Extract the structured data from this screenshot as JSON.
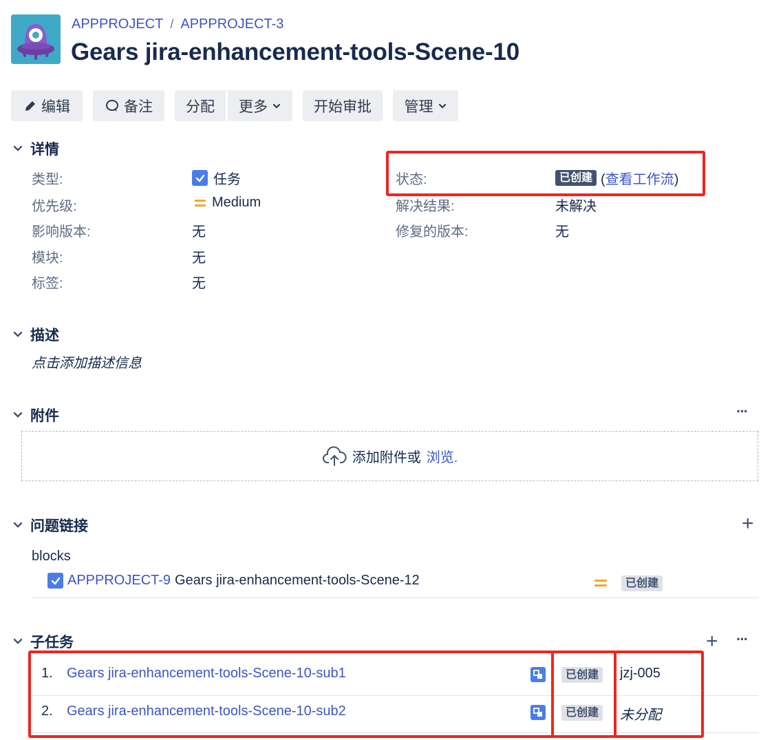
{
  "header": {
    "breadcrumbs": [
      "APPPROJECT",
      "APPPROJECT-3"
    ],
    "separator": "/",
    "summary": "Gears jira-enhancement-tools-Scene-10"
  },
  "toolbar": {
    "edit_label": "编辑",
    "comment_label": "备注",
    "assign_label": "分配",
    "more_label": "更多",
    "start_approval_label": "开始审批",
    "admin_label": "管理"
  },
  "details": {
    "title": "详情",
    "left": [
      {
        "label": "类型:",
        "value": "任务",
        "icon": "task-checkbox-icon"
      },
      {
        "label": "优先级:",
        "value": "Medium",
        "icon": "priority-medium-icon"
      },
      {
        "label": "影响版本:",
        "value": "无"
      },
      {
        "label": "模块:",
        "value": "无"
      },
      {
        "label": "标签:",
        "value": "无"
      }
    ],
    "right": [
      {
        "label": "状态:",
        "status": "已创建",
        "workflow_prefix": "(",
        "workflow_link": "查看工作流",
        "workflow_suffix": ")"
      },
      {
        "label": "解决结果:",
        "value": "未解决"
      },
      {
        "label": "修复的版本:",
        "value": "无"
      }
    ]
  },
  "description": {
    "title": "描述",
    "placeholder": "点击添加描述信息"
  },
  "attachments": {
    "title": "附件",
    "drop_text": "添加附件或",
    "browse_link": "浏览",
    "browse_suffix": ".",
    "menu": "···"
  },
  "issue_links": {
    "title": "问题链接",
    "add": "+",
    "relation": "blocks",
    "items": [
      {
        "key": "APPPROJECT-9",
        "summary": "Gears jira-enhancement-tools-Scene-12",
        "status": "已创建",
        "priority": "medium"
      }
    ]
  },
  "subtasks": {
    "title": "子任务",
    "add": "+",
    "menu": "···",
    "items": [
      {
        "index": "1.",
        "summary": "Gears jira-enhancement-tools-Scene-10-sub1",
        "status": "已创建",
        "assignee": "jzj-005"
      },
      {
        "index": "2.",
        "summary": "Gears jira-enhancement-tools-Scene-10-sub2",
        "status": "已创建",
        "assignee": "未分配"
      }
    ]
  },
  "colors": {
    "link": "#3b55c6",
    "highlight": "#f0251f",
    "priority_medium": "#f5a623",
    "status_dark": "#42526e"
  }
}
